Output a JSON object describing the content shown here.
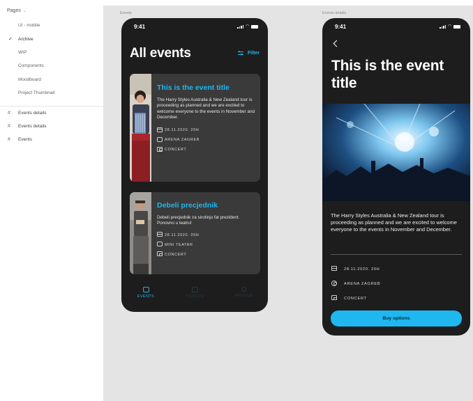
{
  "pages_panel": {
    "header": "Pages",
    "pages": [
      {
        "label": "UI - mobile",
        "checked": false
      },
      {
        "label": "Archive",
        "checked": true
      },
      {
        "label": "WIP",
        "checked": false
      },
      {
        "label": "Components",
        "checked": false
      },
      {
        "label": "Moodboard",
        "checked": false
      },
      {
        "label": "Project Thumbnail",
        "checked": false
      }
    ],
    "frames": [
      "Events details",
      "Events details",
      "Events"
    ]
  },
  "canvas": {
    "frame1_label": "Events",
    "frame2_label": "Events details"
  },
  "events_screen": {
    "status_time": "9:41",
    "title": "All events",
    "filter_label": "Filter",
    "cards": [
      {
        "title": "This is the event title",
        "description": "The Harry Styles Australia & New Zealand tour is proceeding as planned and we are excited to welcome everyone to the events in November and December.",
        "date": "28.11.2020. 20H",
        "venue": "ARENA ZAGREB",
        "category": "CONCERT"
      },
      {
        "title": "Debeli precjednik",
        "description": "Debeli precjednik za sirotinju fat prezident. Ponovno u teatru!",
        "date": "28.11.2020. 20H",
        "venue": "MINI TEATAR",
        "category": "CONCERT"
      }
    ],
    "tabs": [
      {
        "label": "EVENTS",
        "active": true
      },
      {
        "label": "TICKETS",
        "active": false
      },
      {
        "label": "PROFILE",
        "active": false
      }
    ]
  },
  "details_screen": {
    "status_time": "9:41",
    "title": "This is the event title",
    "description": "The Harry Styles Australia & New Zealand tour is proceeding as planned and we are excited to welcome everyone to the events in November and December.",
    "date": "28.11.2020. 20H",
    "venue": "ARENA ZAGREB",
    "category": "CONCERT",
    "buy_label": "Buy options"
  },
  "colors": {
    "accent": "#1fb7ef",
    "phone_bg": "#1d1d1d",
    "card_bg": "#3a3a3a",
    "canvas_bg": "#e4e4e4"
  }
}
